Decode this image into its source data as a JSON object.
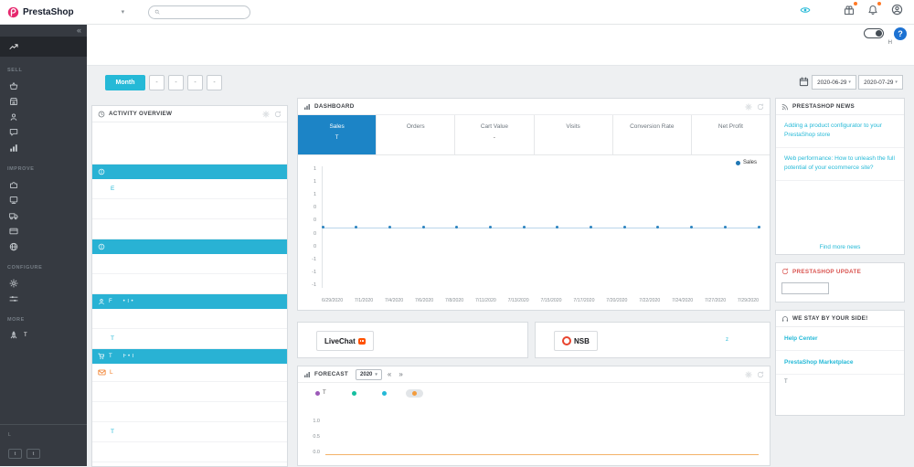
{
  "topbar": {
    "logo": "PrestaShop",
    "search_placeholder": "",
    "caret": "▾"
  },
  "header_bar": {
    "help": "?",
    "label": "H"
  },
  "toolbar": {
    "month_button": "Month",
    "range_buttons": [
      "-",
      "-",
      "-",
      "-"
    ],
    "date_from": "2020-06-29",
    "date_to": "2020-07-29"
  },
  "sidebar": {
    "collapse": "«",
    "sections": [
      {
        "label": "",
        "items": [
          {
            "icon": "trending-up",
            "name": "dashboard",
            "active": true
          }
        ]
      },
      {
        "label": "SELL",
        "items": [
          {
            "icon": "basket",
            "name": "orders"
          },
          {
            "icon": "store",
            "name": "catalog"
          },
          {
            "icon": "person",
            "name": "customers"
          },
          {
            "icon": "chat",
            "name": "customer-service"
          },
          {
            "icon": "stats",
            "name": "stats"
          }
        ]
      },
      {
        "label": "IMPROVE",
        "items": [
          {
            "icon": "puzzle",
            "name": "modules"
          },
          {
            "icon": "monitor",
            "name": "design"
          },
          {
            "icon": "truck",
            "name": "shipping"
          },
          {
            "icon": "card",
            "name": "payment"
          },
          {
            "icon": "globe",
            "name": "international"
          }
        ]
      },
      {
        "label": "CONFIGURE",
        "items": [
          {
            "icon": "gear",
            "name": "shop-parameters"
          },
          {
            "icon": "sliders",
            "name": "advanced-parameters"
          }
        ]
      },
      {
        "label": "MORE",
        "items": [
          {
            "icon": "rocket",
            "name": "modules-marketplace",
            "text": "T"
          }
        ]
      }
    ],
    "footer": {
      "note": "L",
      "buttons": [
        "t",
        "t"
      ]
    }
  },
  "activity": {
    "title": "ACTIVITY OVERVIEW",
    "rows": [
      {
        "type": "spacer"
      },
      {
        "type": "header",
        "icon": "info",
        "text": ""
      },
      {
        "type": "link",
        "text": "E"
      },
      {
        "type": "blank"
      },
      {
        "type": "blank"
      },
      {
        "type": "header",
        "icon": "info",
        "text": ""
      },
      {
        "type": "blank"
      },
      {
        "type": "blank"
      },
      {
        "type": "header",
        "icon": "person",
        "text": "F",
        "sub": "• T •"
      },
      {
        "type": "blank"
      },
      {
        "type": "link",
        "text": "T"
      },
      {
        "type": "header",
        "icon": "cart",
        "text": "T",
        "sub": "F • T"
      },
      {
        "type": "mail",
        "text": "L"
      },
      {
        "type": "blank"
      },
      {
        "type": "blank"
      },
      {
        "type": "link",
        "text": "T"
      },
      {
        "type": "blank"
      }
    ]
  },
  "dashboard": {
    "title": "DASHBOARD",
    "legend": "Sales",
    "tabs": [
      {
        "label": "Sales",
        "value": "T",
        "active": true
      },
      {
        "label": "Orders",
        "value": "",
        "active": false
      },
      {
        "label": "Cart Value",
        "value": "-",
        "active": false
      },
      {
        "label": "Visits",
        "value": "",
        "active": false
      },
      {
        "label": "Conversion Rate",
        "value": "",
        "active": false
      },
      {
        "label": "Net Profit",
        "value": "",
        "active": false
      }
    ],
    "chart_data": {
      "type": "line",
      "title": "Sales",
      "x": [
        "6/29/2020",
        "7/1/2020",
        "7/4/2020",
        "7/6/2020",
        "7/8/2020",
        "7/11/2020",
        "7/13/2020",
        "7/15/2020",
        "7/17/2020",
        "7/20/2020",
        "7/22/2020",
        "7/24/2020",
        "7/27/2020",
        "7/29/2020"
      ],
      "series": [
        {
          "name": "Sales",
          "color": "#2e85c0",
          "values": [
            0,
            0,
            0,
            0,
            0,
            0,
            0,
            0,
            0,
            0,
            0,
            0,
            0,
            0
          ]
        }
      ],
      "ylim": [
        -1,
        1
      ],
      "y_tick_labels": [
        "1",
        "1",
        "1",
        "0",
        "0",
        "0",
        "0",
        "-1",
        "-1",
        "-1"
      ],
      "grid": false,
      "legend_position": "top-right"
    }
  },
  "partners": {
    "livechat": {
      "brand": "LiveChat"
    },
    "nsb": {
      "brand": "NSB",
      "link": "z"
    }
  },
  "forecast": {
    "title": "FORECAST",
    "year": "2020",
    "prev": "«",
    "next": "»",
    "legend": [
      {
        "label": "T",
        "color": "#9c59b8",
        "selected": false
      },
      {
        "label": "",
        "color": "#16bfa0",
        "selected": false
      },
      {
        "label": "",
        "color": "#25b9d7",
        "selected": false
      },
      {
        "label": "",
        "color": "#f39c3d",
        "selected": true
      }
    ],
    "chart_data": {
      "type": "line",
      "y_tick_labels": [
        "1.0",
        "0.5",
        "0.0"
      ],
      "ylim": [
        0,
        1
      ],
      "series": [
        {
          "name": "Forecast",
          "color": "#f3b269",
          "values": [
            0,
            0
          ]
        }
      ]
    }
  },
  "news": {
    "title": "PRESTASHOP NEWS",
    "items": [
      "Adding a product configurator to your PrestaShop store",
      "Web performance: How to unleash the full potential of your ecommerce site?"
    ],
    "footer": "Find more news"
  },
  "update": {
    "title": "PRESTASHOP UPDATE",
    "input_value": ""
  },
  "support": {
    "title": "WE STAY BY YOUR SIDE!",
    "links": [
      "Help Center",
      "PrestaShop Marketplace"
    ],
    "note": "T"
  },
  "colors": {
    "primary": "#25b9d7",
    "tab_active": "#1c84c6",
    "sidebar_bg": "#363a41",
    "update_title": "#d9534f",
    "badge": "#ff7926"
  }
}
